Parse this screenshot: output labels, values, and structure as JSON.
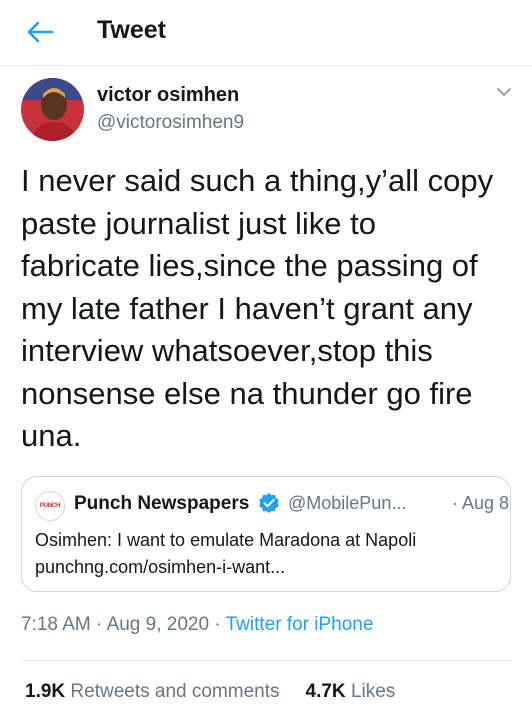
{
  "header": {
    "back_icon": "arrow-left-icon",
    "title": "Tweet"
  },
  "colors": {
    "accent": "#1da1f2",
    "text": "#14171a",
    "secondary": "#657786",
    "border": "#ccd6dd"
  },
  "tweet": {
    "author": {
      "display_name": "victor osimhen",
      "handle": "@victorosimhen9",
      "avatar_icon": "avatar-photo"
    },
    "menu_icon": "chevron-down-icon",
    "text_lines": [
      "I never said such a thing,y’all copy",
      "paste journalist just like to",
      "fabricate lies,since the passing of",
      "my late father  I haven’t grant any",
      "interview whatsoever,stop this",
      "nonsense else na thunder go fire",
      "una."
    ],
    "quoted": {
      "logo_text": "PUNCH",
      "name": "Punch Newspapers",
      "verified_icon": "verified-badge-icon",
      "handle": "@MobilePun...",
      "date": "· Aug 8",
      "text": "Osimhen: I want to emulate Maradona at Napoli",
      "link": "punchng.com/osimhen-i-want..."
    },
    "time": "7:18 AM",
    "date": "Aug 9, 2020",
    "separator": "·",
    "source": "Twitter for iPhone",
    "stats": {
      "retweets_count": "1.9K",
      "retweets_label": "Retweets and comments",
      "likes_count": "4.7K",
      "likes_label": "Likes"
    }
  }
}
